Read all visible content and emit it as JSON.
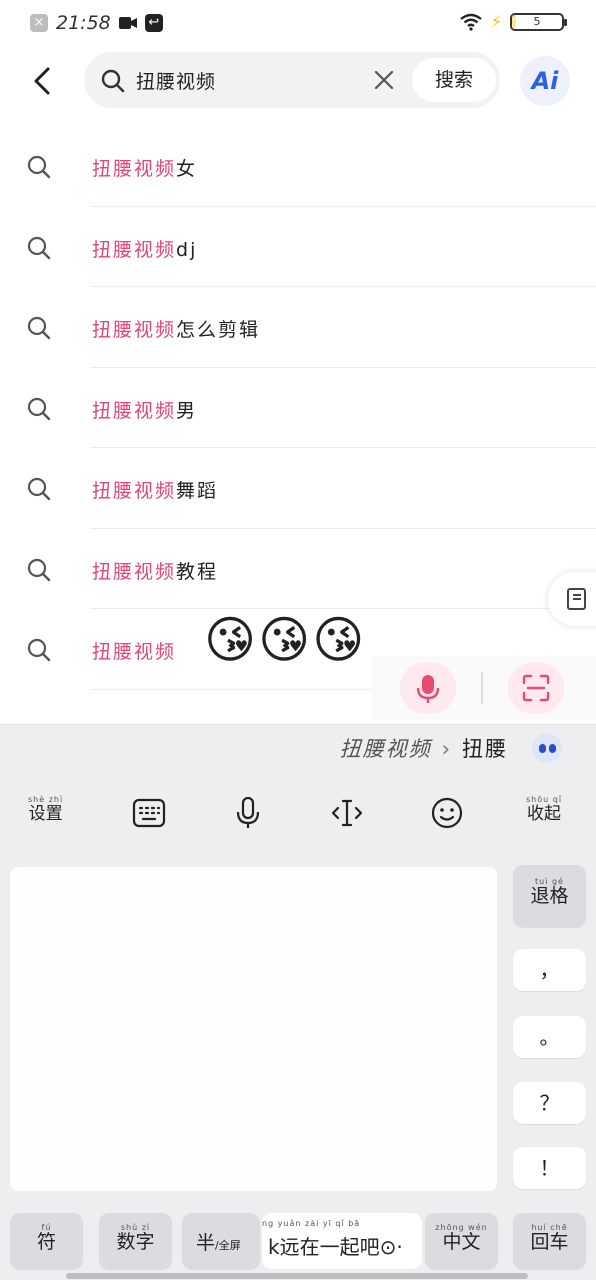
{
  "status_bar": {
    "time": "21:58",
    "battery": "5",
    "battery_level_percent": 5,
    "icons": [
      "app-notification-icon",
      "video-icon",
      "app-icon",
      "wifi-icon",
      "charging-icon",
      "battery-icon"
    ]
  },
  "search": {
    "query": "扭腰视频",
    "search_button": "搜索",
    "ai_label": "Ai"
  },
  "suggestions": [
    {
      "highlight": "扭腰视频",
      "rest": "女"
    },
    {
      "highlight": "扭腰视频",
      "rest": "dj"
    },
    {
      "highlight": "扭腰视频",
      "rest": "怎么剪辑"
    },
    {
      "highlight": "扭腰视频",
      "rest": "男"
    },
    {
      "highlight": "扭腰视频",
      "rest": "舞蹈"
    },
    {
      "highlight": "扭腰视频",
      "rest": "教程"
    },
    {
      "highlight": "扭腰视频",
      "rest": ""
    }
  ],
  "emoji_overlay": "😘😘😘",
  "keyboard": {
    "candidate_prev": "扭腰视频",
    "candidate_current": "扭腰",
    "toolbar": {
      "settings": {
        "pinyin": "shè zhì",
        "label": "设置"
      },
      "collapse": {
        "pinyin": "shōu qǐ",
        "label": "收起"
      }
    },
    "right_keys": {
      "backspace": {
        "pinyin": "tuì gé",
        "label": "退格"
      },
      "comma": "，",
      "period": "。",
      "question": "？",
      "exclaim": "！"
    },
    "bottom": {
      "symbols": {
        "pinyin": "fú",
        "label": "符"
      },
      "numbers": {
        "pinyin": "shù zì",
        "label": "数字"
      },
      "half_label": "半",
      "half_sub": "/全屏",
      "space_pinyin": "ng yuǎn zài yī qǐ bā",
      "space_text": "k远在一起吧⊙·",
      "chinese": {
        "pinyin": "zhōng wén",
        "label": "中文"
      },
      "enter": {
        "pinyin": "huí chē",
        "label": "回车"
      }
    }
  }
}
